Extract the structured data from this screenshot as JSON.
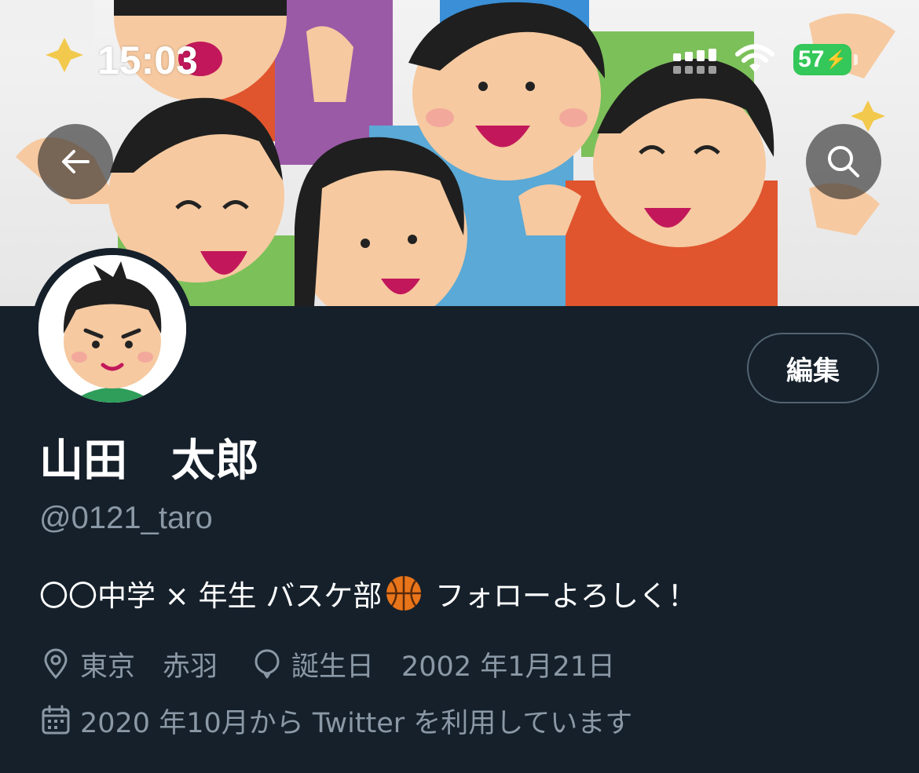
{
  "status_bar": {
    "time": "15:03",
    "battery": "57"
  },
  "header": {
    "back_icon": "arrow-left-icon",
    "search_icon": "search-icon"
  },
  "profile": {
    "display_name": "山田　太郎",
    "handle": "@0121_taro",
    "edit_label": "編集",
    "bio_text": "〇〇中学 × 年生 バスケ部",
    "bio_emoji": "basketball-icon",
    "bio_tail": " フォローよろしく！",
    "location": "東京　赤羽",
    "birthday": "誕生日　2002 年1月21日",
    "joined": "2020 年10月から Twitter を利用しています"
  },
  "colors": {
    "background": "#15202b",
    "secondary_text": "#8b98a5",
    "battery": "#34c759",
    "border": "#536471"
  }
}
